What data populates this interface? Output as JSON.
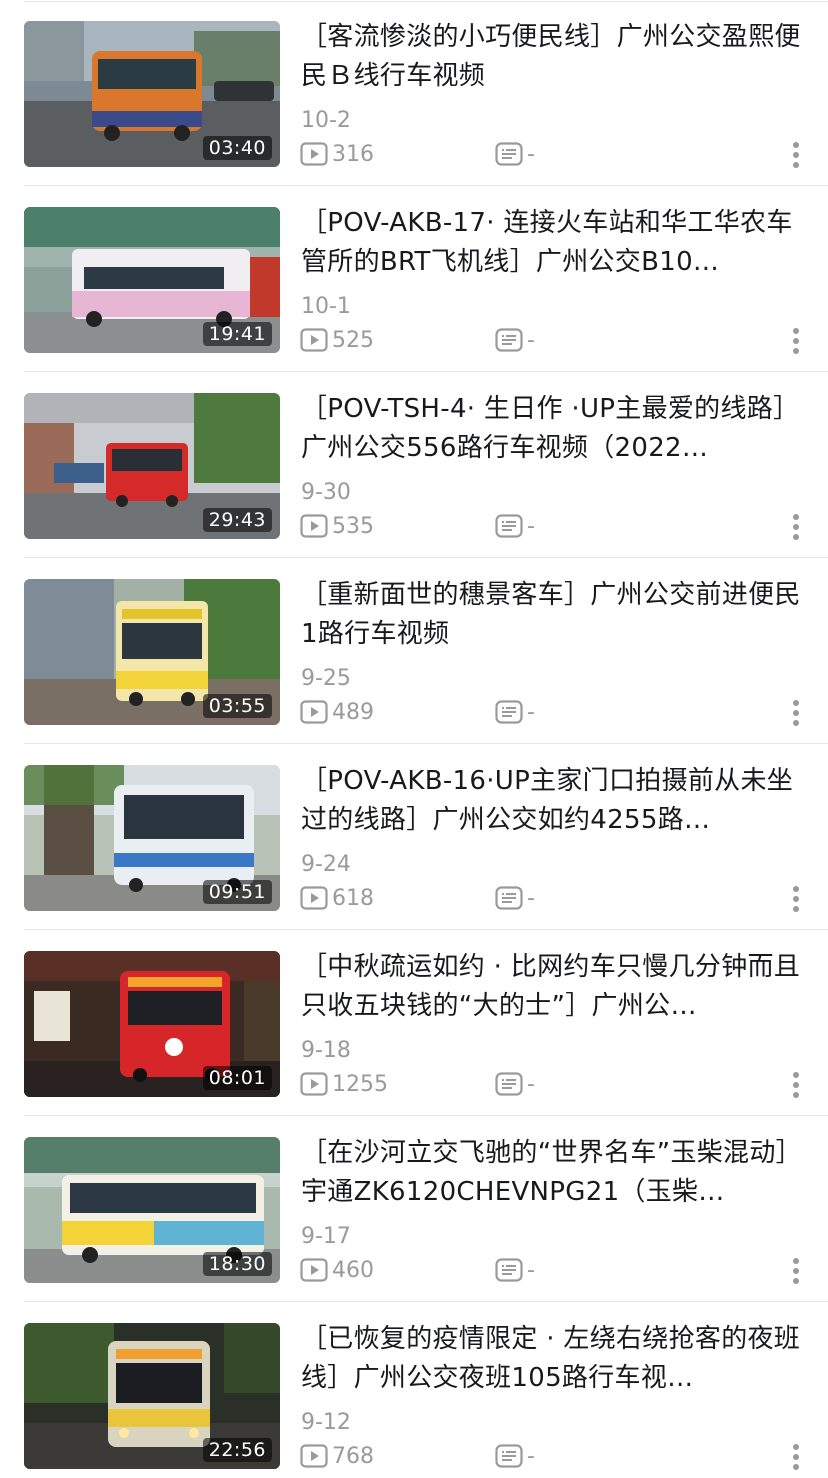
{
  "videos": [
    {
      "title": "［客流惨淡的小巧便民线］广州公交盈熙便民Ｂ线行车视频",
      "duration": "03:40",
      "date": "10-2",
      "plays": "316",
      "danmaku": "-"
    },
    {
      "title": "［POV-AKB-17· 连接火车站和华工华农车管所的BRT飞机线］广州公交B10…",
      "duration": "19:41",
      "date": "10-1",
      "plays": "525",
      "danmaku": "-"
    },
    {
      "title": "［POV-TSH-4· 生日作 ·UP主最爱的线路］广州公交556路行车视频（2022…",
      "duration": "29:43",
      "date": "9-30",
      "plays": "535",
      "danmaku": "-"
    },
    {
      "title": "［重新面世的穗景客车］广州公交前进便民1路行车视频",
      "duration": "03:55",
      "date": "9-25",
      "plays": "489",
      "danmaku": "-"
    },
    {
      "title": "［POV-AKB-16·UP主家门口拍摄前从未坐过的线路］广州公交如约4255路…",
      "duration": "09:51",
      "date": "9-24",
      "plays": "618",
      "danmaku": "-"
    },
    {
      "title": "［中秋疏运如约 · 比网约车只慢几分钟而且只收五块钱的“大的士”］广州公…",
      "duration": "08:01",
      "date": "9-18",
      "plays": "1255",
      "danmaku": "-"
    },
    {
      "title": "［在沙河立交飞驰的“世界名车”玉柴混动］宇通ZK6120CHEVNPG21（玉柴…",
      "duration": "18:30",
      "date": "9-17",
      "plays": "460",
      "danmaku": "-"
    },
    {
      "title": "［已恢复的疫情限定 · 左绕右绕抢客的夜班线］广州公交夜班105路行车视…",
      "duration": "22:56",
      "date": "9-12",
      "plays": "768",
      "danmaku": "-"
    }
  ],
  "icons": {
    "play_count": "play-count-icon",
    "danmaku_count": "danmaku-icon",
    "more": "more-options-icon"
  },
  "colors": {
    "text_primary": "#18191c",
    "text_secondary": "#9a9a9a",
    "divider": "#e6e6e6"
  }
}
